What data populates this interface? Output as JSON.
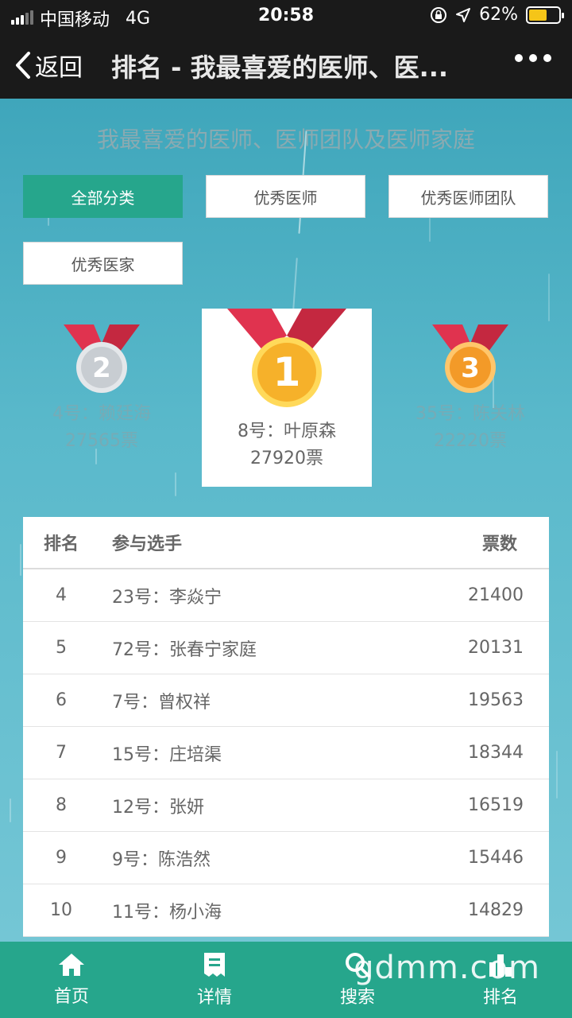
{
  "status_bar": {
    "carrier": "中国移动",
    "network": "4G",
    "time": "20:58",
    "battery_percent": "62%",
    "battery_level": 0.62
  },
  "nav": {
    "back_label": "返回",
    "title": "排名 - 我最喜爱的医师、医..."
  },
  "page_heading": "我最喜爱的医师、医师团队及医师家庭",
  "categories": [
    {
      "label": "全部分类",
      "active": true
    },
    {
      "label": "优秀医师",
      "active": false
    },
    {
      "label": "优秀医师团队",
      "active": false
    },
    {
      "label": "优秀医家",
      "active": false
    }
  ],
  "podium": {
    "first": {
      "rank": "1",
      "name": "8号：叶原森",
      "votes": "27920票"
    },
    "second": {
      "rank": "2",
      "name": "4号：赖廷海",
      "votes": "27565票"
    },
    "third": {
      "rank": "3",
      "name": "35号：陈关林",
      "votes": "22220票"
    }
  },
  "table": {
    "headers": {
      "rank": "排名",
      "name": "参与选手",
      "votes": "票数"
    },
    "rows": [
      {
        "rank": "4",
        "name": "23号：李焱宁",
        "votes": "21400"
      },
      {
        "rank": "5",
        "name": "72号：张春宁家庭",
        "votes": "20131"
      },
      {
        "rank": "6",
        "name": "7号：曾权祥",
        "votes": "19563"
      },
      {
        "rank": "7",
        "name": "15号：庄培渠",
        "votes": "18344"
      },
      {
        "rank": "8",
        "name": "12号：张妍",
        "votes": "16519"
      },
      {
        "rank": "9",
        "name": "9号：陈浩然",
        "votes": "15446"
      },
      {
        "rank": "10",
        "name": "11号：杨小海",
        "votes": "14829"
      }
    ]
  },
  "tab_bar": [
    {
      "label": "首页",
      "icon": "home-icon"
    },
    {
      "label": "详情",
      "icon": "details-icon"
    },
    {
      "label": "搜索",
      "icon": "search-icon"
    },
    {
      "label": "排名",
      "icon": "ranking-icon"
    }
  ],
  "watermark": "gdmm.com",
  "colors": {
    "accent": "#26a68c",
    "medal_gold": "#f6b12a",
    "medal_silver": "#c8cdd2",
    "medal_bronze": "#f39a28",
    "ribbon": "#e0334f"
  }
}
